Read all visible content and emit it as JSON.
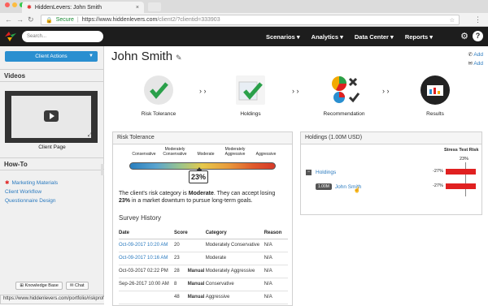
{
  "browser": {
    "tab_title": "HiddenLevers: John Smith",
    "tab_close": "×",
    "secure_label": "Secure",
    "url_base": "https://www.hiddenlevers.com",
    "url_path": "/client2/?clientid=333903"
  },
  "appbar": {
    "search_placeholder": "Search...",
    "menu": [
      "Scenarios ▾",
      "Analytics ▾",
      "Data Center ▾",
      "Reports ▾"
    ],
    "help": "?"
  },
  "sidebar": {
    "client_actions": "Client Actions",
    "videos_title": "Videos",
    "video_caption": "Client Page",
    "howto_title": "How-To",
    "howto_links": [
      "Marketing Materials",
      "Client Workflow",
      "Questionnaire Design"
    ],
    "kb_button": "Knowledge Base",
    "chat_button": "Chat"
  },
  "status_url": "https://www.hiddenlevers.com/portfolio/riskprofile?portfolioid=7620578",
  "main": {
    "client_name": "John Smith",
    "add_links": [
      "Add",
      "Add"
    ],
    "steps": [
      "Risk Tolerance",
      "Holdings",
      "Recommendation",
      "Results"
    ],
    "arrows": "› ›"
  },
  "risk_panel": {
    "title": "Risk Tolerance",
    "scale": [
      "Conservative",
      "Moderately Conservative",
      "Moderate",
      "Moderately Aggressive",
      "Aggressive"
    ],
    "score": "23%",
    "desc_pre": "The client's risk category is ",
    "desc_cat": "Moderate",
    "desc_mid": ". They can accept losing ",
    "desc_pct": "23%",
    "desc_post": " in a market downturn to pursue long-term goals.",
    "history_title": "Survey History",
    "columns": [
      "Date",
      "Score",
      "",
      "Category",
      "Reason"
    ],
    "rows": [
      [
        "Oct-09-2017 10:20 AM",
        "20",
        "",
        "Moderately Conservative",
        "N/A"
      ],
      [
        "Oct-09-2017 10:16 AM",
        "23",
        "",
        "Moderate",
        "N/A"
      ],
      [
        "Oct-03-2017 02:22 PM",
        "28",
        "Manual",
        "Moderately Aggressive",
        "N/A"
      ],
      [
        "Sep-26-2017 10:00 AM",
        "8",
        "Manual",
        "Conservative",
        "N/A"
      ],
      [
        "",
        "48",
        "Manual",
        "Aggressive",
        "N/A"
      ]
    ]
  },
  "holdings_panel": {
    "title": "Holdings (1.00M USD)",
    "stress_head": "Stress Test Risk",
    "stress_pct": "23%",
    "group_label": "Holdings",
    "group_pct": "-27%",
    "badge": "1.00M",
    "account_label": "John Smith",
    "account_pct": "-27%"
  },
  "colors": {
    "accent": "#2a8fd0",
    "link": "#2a7abf",
    "stress": "#e02020",
    "check": "#2aa04a"
  }
}
